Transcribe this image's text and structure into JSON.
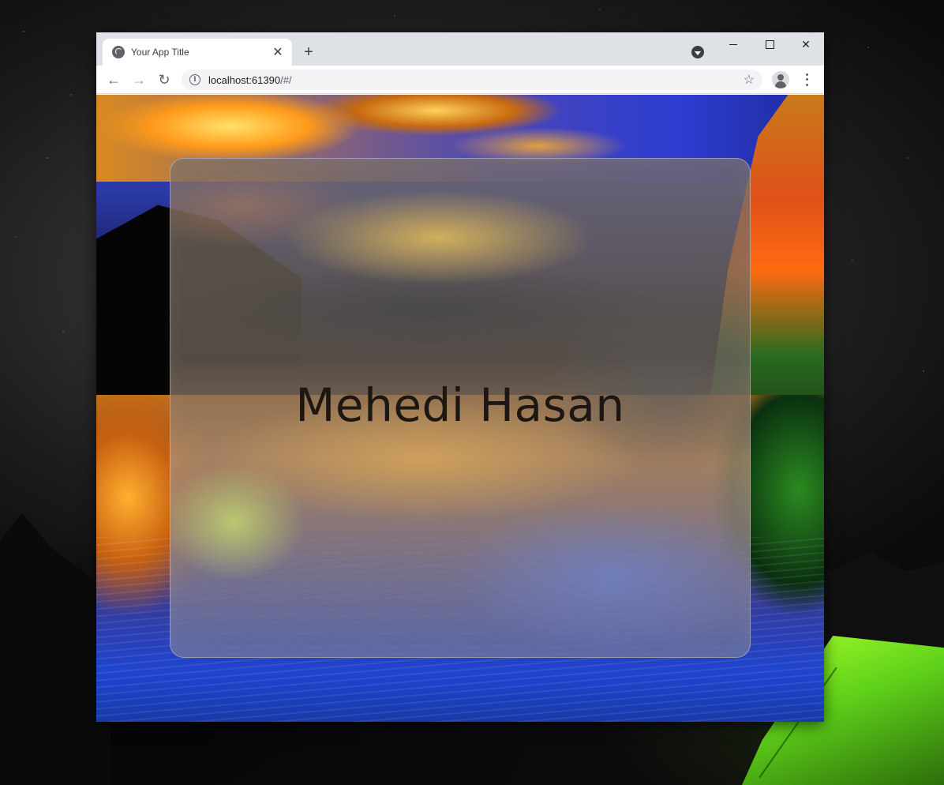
{
  "browser": {
    "tab": {
      "title": "Your App Title",
      "close_glyph": "✕"
    },
    "new_tab_glyph": "+",
    "address_bar": {
      "host": "localhost:61390",
      "path": "/#/"
    },
    "nav": {
      "back_glyph": "←",
      "forward_glyph": "→",
      "reload_glyph": "↻"
    },
    "bookmark_glyph": "☆",
    "window_controls": {
      "close_glyph": "✕"
    }
  },
  "page": {
    "card_text": "Mehedi Hasan"
  },
  "icons": {
    "tab_favicon": "globe-icon",
    "tab_search": "tab-search-icon",
    "site_info": "info-icon",
    "bookmark": "star-icon",
    "profile": "profile-icon",
    "menu": "kebab-menu-icon"
  }
}
